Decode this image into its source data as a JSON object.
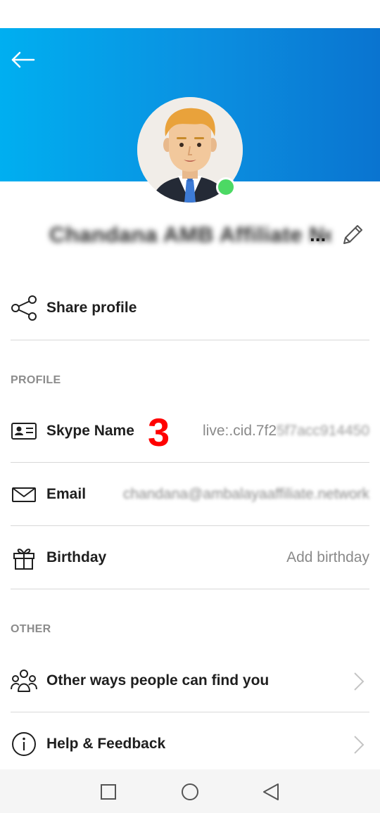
{
  "profile": {
    "display_name": "Chandana AMB Affiliate Network",
    "ellipsis": "..."
  },
  "share": {
    "label": "Share profile"
  },
  "sections": {
    "profile_title": "PROFILE",
    "other_title": "OTHER"
  },
  "fields": {
    "skype_name": {
      "label": "Skype Name",
      "value_visible": "live:.cid.7f2",
      "value_blurred": "5f7acc914450"
    },
    "email": {
      "label": "Email",
      "value": "chandana@ambalayaaffiliate.network"
    },
    "birthday": {
      "label": "Birthday",
      "value": "Add birthday"
    }
  },
  "other": {
    "find_you": "Other ways people can find you",
    "help": "Help & Feedback"
  },
  "annotation": {
    "marker": "3"
  },
  "colors": {
    "header_start": "#00aff0",
    "header_end": "#0a74d0",
    "presence": "#4cd964",
    "annotation": "#ff0000"
  },
  "icons": {
    "back": "arrow-left-icon",
    "edit": "pencil-icon",
    "share": "share-icon",
    "skype_name": "id-card-icon",
    "email": "envelope-icon",
    "birthday": "gift-icon",
    "find_you": "people-icon",
    "help": "info-icon",
    "chevron": "chevron-right-icon",
    "nav_recents": "square-icon",
    "nav_home": "circle-icon",
    "nav_back": "triangle-back-icon"
  }
}
